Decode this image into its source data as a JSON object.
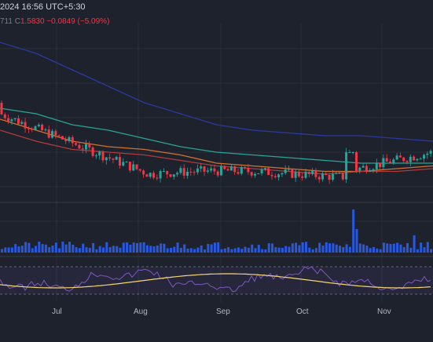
{
  "header": {
    "datetime": "2024 16:56 UTC+5:30",
    "ohlc_partial_prefix": "711",
    "close_label": "C",
    "close_value": "1.5830",
    "change": "−0.0849 (−5.09%)"
  },
  "colors": {
    "background": "#1e222d",
    "grid": "#2a2e39",
    "up": "#26a69a",
    "down": "#f23645",
    "volume": "#2962ff",
    "ma_slow": "#2b3a9e",
    "ma_mid": "#26a69a",
    "ma_fast": "#d3722e",
    "ma_faster": "#b23b3b",
    "rsi_line": "#7e57c2",
    "rsi_ma": "#f5d56f"
  },
  "x_axis": {
    "labels": [
      "Jul",
      "Aug",
      "Sep",
      "Oct",
      "Nov"
    ]
  },
  "chart_data": {
    "type": "line",
    "series": [
      {
        "values": [
          4.2,
          4.0,
          3.7,
          3.4,
          3.1,
          2.9,
          2.7,
          2.6,
          2.55,
          2.5,
          2.5,
          2.45,
          2.4
        ]
      },
      {
        "values": [
          3.0,
          2.9,
          2.7,
          2.6,
          2.45,
          2.3,
          2.2,
          2.15,
          2.1,
          2.05,
          2.0,
          2.0,
          2.0
        ]
      },
      {
        "values": [
          2.8,
          2.6,
          2.4,
          2.3,
          2.25,
          2.15,
          2.0,
          1.95,
          1.9,
          1.85,
          1.85,
          1.9,
          1.95
        ]
      },
      {
        "values": [
          2.6,
          2.4,
          2.25,
          2.2,
          2.15,
          2.05,
          1.95,
          1.9,
          1.85,
          1.8,
          1.85,
          1.85,
          1.9
        ]
      }
    ]
  }
}
